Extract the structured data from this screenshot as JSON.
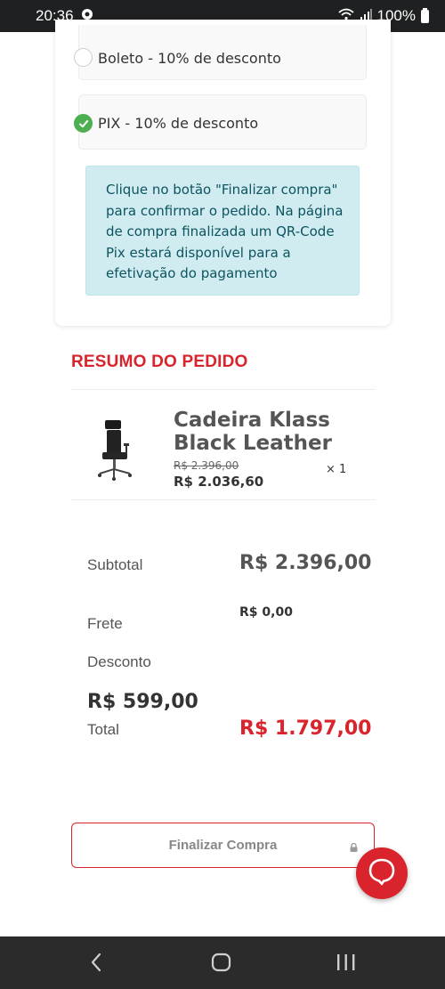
{
  "status_bar": {
    "time": "20:36",
    "battery": "100%"
  },
  "payment": {
    "options": [
      {
        "label": "Boleto - 10% de desconto",
        "selected": false
      },
      {
        "label": "PIX - 10% de desconto",
        "selected": true
      }
    ],
    "info": "Clique no botão \"Finalizar compra\" para confirmar o pedido. Na página de compra finalizada um QR-Code Pix estará disponível para a efetivação do pagamento"
  },
  "summary": {
    "title": "RESUMO DO PEDIDO",
    "product": {
      "name": "Cadeira Klass Black Leather",
      "old_price": "R$ 2.396,00",
      "price": "R$ 2.036,60",
      "quantity": "× 1"
    },
    "subtotal_label": "Subtotal",
    "subtotal_value": "R$ 2.396,00",
    "frete_label": "Frete",
    "frete_value": "R$ 0,00",
    "desconto_label": "Desconto",
    "desconto_value": "R$ 599,00",
    "total_label": "Total",
    "total_value": "R$ 1.797,00"
  },
  "actions": {
    "finalize_label": "Finalizar Compra"
  },
  "colors": {
    "accent": "#d9232d",
    "success": "#4caf50",
    "info_bg": "#d1ecf1",
    "info_text": "#0c5460"
  },
  "icons": {
    "chat": "chat-bubble-icon",
    "lock": "lock-icon",
    "check": "check-icon",
    "wifi": "wifi-icon",
    "signal": "signal-icon",
    "battery": "battery-icon",
    "back": "back-icon",
    "home": "home-icon",
    "recent": "recent-apps-icon"
  }
}
